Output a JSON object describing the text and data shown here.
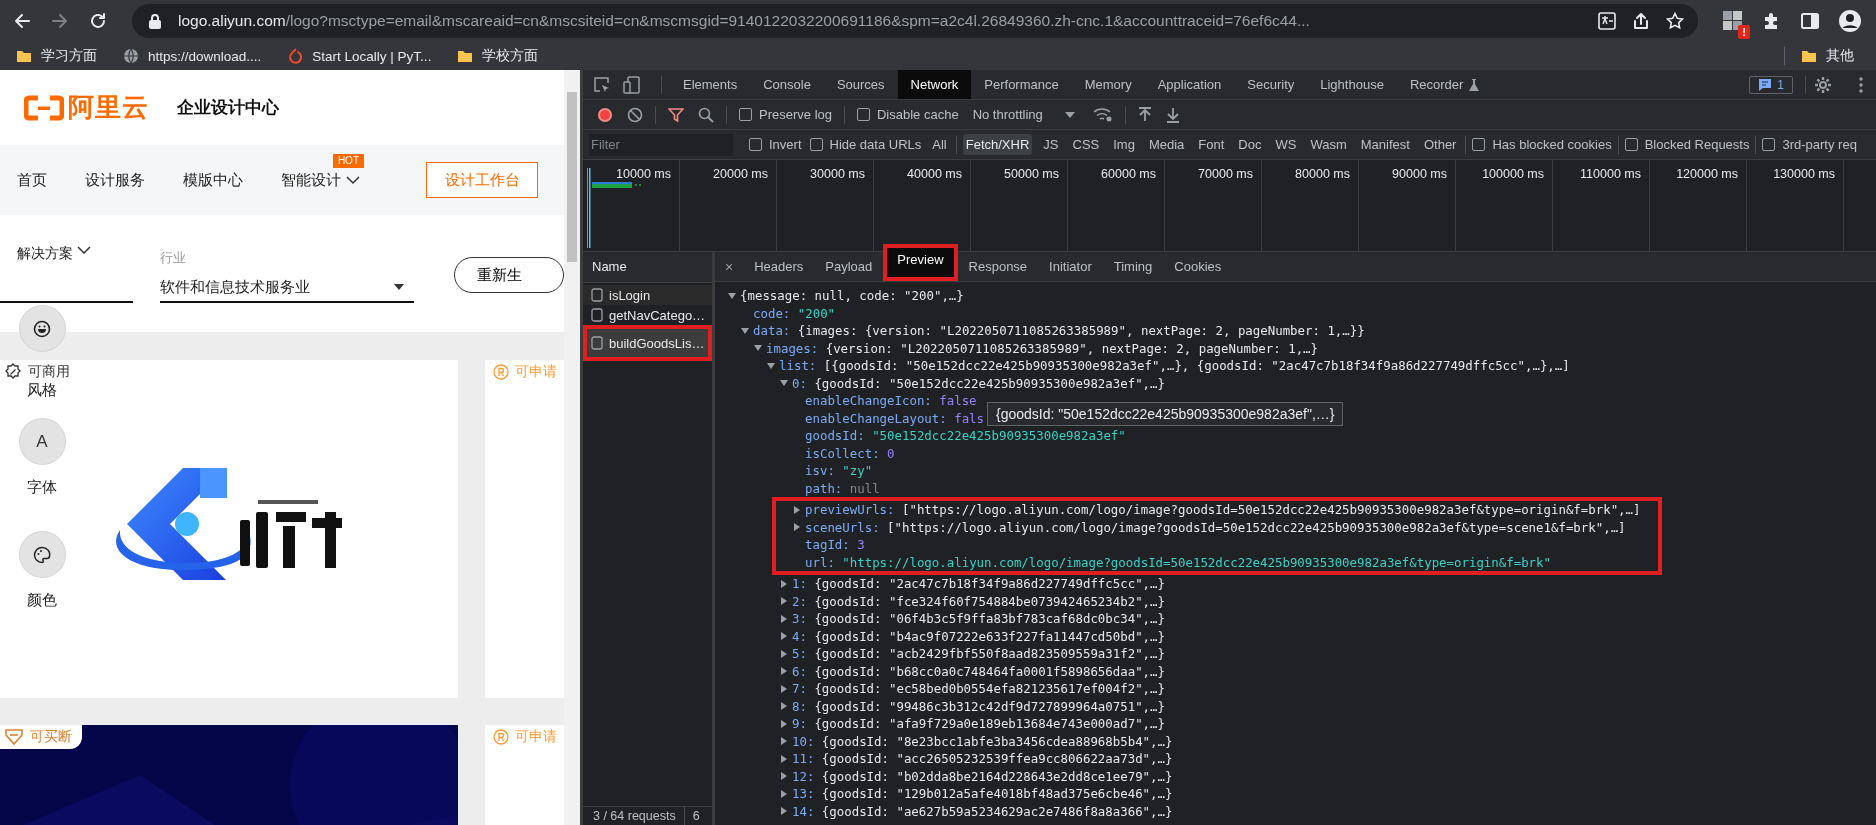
{
  "browser": {
    "address": {
      "host": "logo.aliyun.com",
      "path": "/logo?msctype=email&mscareaid=cn&mscsiteid=cn&mscmsgid=9140122032200691186&spm=a2c4l.26849360.zh-cnc.1&accounttraceid=76ef6c44..."
    },
    "extension_badge": "!",
    "bookmarks": [
      {
        "label": "学习方面",
        "kind": "folder"
      },
      {
        "label": "https://download....",
        "kind": "globe"
      },
      {
        "label": "Start Locally | PyT...",
        "kind": "ring"
      },
      {
        "label": "学校方面",
        "kind": "folder"
      }
    ],
    "other_bookmarks": "其他"
  },
  "page": {
    "brand": {
      "logo_text": "阿里云",
      "title": "企业设计中心"
    },
    "nav": [
      {
        "label": "首页"
      },
      {
        "label": "设计服务"
      },
      {
        "label": "模版中心"
      },
      {
        "label": "智能设计",
        "badge": "HOT",
        "dropdown": true
      }
    ],
    "workbench_button": "设计工作台",
    "solution": {
      "label": "解决方案"
    },
    "industry": {
      "label": "行业",
      "value": "软件和信息技术服务业"
    },
    "regenerate_button": "重新生",
    "tools": [
      {
        "label": "风格",
        "kind": "face"
      },
      {
        "label": "字体",
        "kind": "glyph",
        "glyph": "A"
      },
      {
        "label": "颜色",
        "kind": "palette"
      }
    ],
    "cards": [
      {
        "badge": {
          "text": "可商用",
          "kind": "commercial"
        },
        "kind": "light_picture"
      },
      {
        "badge": {
          "text": "可申请",
          "kind": "trademark"
        },
        "kind": "blank"
      },
      {
        "badge": {
          "text": "可买断",
          "kind": "buyout"
        },
        "kind": "dark_picture"
      },
      {
        "badge": {
          "text": "可申请",
          "kind": "trademark"
        },
        "kind": "blank"
      }
    ]
  },
  "devtools": {
    "tabs": [
      {
        "label": "Elements",
        "selected": false
      },
      {
        "label": "Console",
        "selected": false
      },
      {
        "label": "Sources",
        "selected": false
      },
      {
        "label": "Network",
        "selected": true
      },
      {
        "label": "Performance",
        "selected": false
      },
      {
        "label": "Memory",
        "selected": false
      },
      {
        "label": "Application",
        "selected": false
      },
      {
        "label": "Security",
        "selected": false
      },
      {
        "label": "Lighthouse",
        "selected": false
      },
      {
        "label": "Recorder",
        "selected": false
      }
    ],
    "issues_count": "1",
    "recording": true,
    "filter_active": true,
    "preserve_log": {
      "label": "Preserve log",
      "checked": false
    },
    "disable_cache": {
      "label": "Disable cache",
      "checked": false
    },
    "throttling": "No throttling",
    "filter": {
      "placeholder": "Filter"
    },
    "invert": {
      "label": "Invert",
      "checked": false
    },
    "hide_data_urls": {
      "label": "Hide data URLs",
      "checked": false
    },
    "types": [
      {
        "label": "All",
        "selected": false
      },
      {
        "label": "Fetch/XHR",
        "selected": true
      },
      {
        "label": "JS",
        "selected": false
      },
      {
        "label": "CSS",
        "selected": false
      },
      {
        "label": "Img",
        "selected": false
      },
      {
        "label": "Media",
        "selected": false
      },
      {
        "label": "Font",
        "selected": false
      },
      {
        "label": "Doc",
        "selected": false
      },
      {
        "label": "WS",
        "selected": false
      },
      {
        "label": "Wasm",
        "selected": false
      },
      {
        "label": "Manifest",
        "selected": false
      },
      {
        "label": "Other",
        "selected": false
      }
    ],
    "has_blocked_cookies": {
      "label": "Has blocked cookies",
      "checked": false
    },
    "blocked_requests": {
      "label": "Blocked Requests",
      "checked": false
    },
    "third_party": {
      "label": "3rd-party req",
      "checked": false
    },
    "overview_ticks": [
      "10000 ms",
      "20000 ms",
      "30000 ms",
      "40000 ms",
      "50000 ms",
      "60000 ms",
      "70000 ms",
      "80000 ms",
      "90000 ms",
      "100000 ms",
      "110000 ms",
      "120000 ms",
      "130000 ms"
    ],
    "name_header": "Name",
    "requests": [
      {
        "name": "isLogin",
        "selected": false,
        "highlighted": false
      },
      {
        "name": "getNavCatego…",
        "selected": false,
        "highlighted": false
      },
      {
        "name": "buildGoodsLis…",
        "selected": true,
        "highlighted": true
      }
    ],
    "status": "3 / 64 requests",
    "status_extra": "6",
    "detail_close": "×",
    "detail_tabs": [
      {
        "label": "Headers",
        "selected": false,
        "highlighted": false
      },
      {
        "label": "Payload",
        "selected": false,
        "highlighted": false
      },
      {
        "label": "Preview",
        "selected": true,
        "highlighted": true
      },
      {
        "label": "Response",
        "selected": false,
        "highlighted": false
      },
      {
        "label": "Initiator",
        "selected": false,
        "highlighted": false
      },
      {
        "label": "Timing",
        "selected": false,
        "highlighted": false
      },
      {
        "label": "Cookies",
        "selected": false,
        "highlighted": false
      }
    ],
    "preview": {
      "kind": "branch",
      "expanded": true,
      "value": {
        "text": "{message: null, code: \"200\",…}",
        "kind": "preview"
      },
      "children": [
        {
          "kind": "leaf",
          "key": "code:",
          "value": {
            "text": "\"200\"",
            "kind": "string"
          }
        },
        {
          "kind": "branch",
          "expanded": true,
          "key": "data:",
          "value": {
            "text": "{images: {version: \"L2022050711085263385989\", nextPage: 2, pageNumber: 1,…}}",
            "kind": "preview"
          },
          "children": [
            {
              "kind": "branch",
              "expanded": true,
              "key": "images:",
              "value": {
                "text": "{version: \"L2022050711085263385989\", nextPage: 2, pageNumber: 1,…}",
                "kind": "preview"
              },
              "children": [
                {
                  "kind": "branch",
                  "expanded": true,
                  "key": "list:",
                  "value": {
                    "text": "[{goodsId: \"50e152dcc22e425b90935300e982a3ef\",…}, {goodsId: \"2ac47c7b18f34f9a86d227749dffc5cc\",…},…]",
                    "kind": "preview"
                  },
                  "children": [
                    {
                      "kind": "branch",
                      "expanded": true,
                      "key": "0:",
                      "value": {
                        "text": "{goodsId: \"50e152dcc22e425b90935300e982a3ef\",…}",
                        "kind": "preview"
                      },
                      "children": [
                        {
                          "kind": "leaf",
                          "key": "enableChangeIcon:",
                          "value": {
                            "text": "false",
                            "kind": "boolean"
                          },
                          "highlighted": false
                        },
                        {
                          "kind": "leaf",
                          "key": "enableChangeLayout:",
                          "value": {
                            "text": "fals",
                            "kind": "boolean"
                          },
                          "highlighted": false
                        },
                        {
                          "kind": "leaf",
                          "key": "goodsId:",
                          "value": {
                            "text": "\"50e152dcc22e425b90935300e982a3ef\"",
                            "kind": "string"
                          },
                          "highlighted": false
                        },
                        {
                          "kind": "leaf",
                          "key": "isCollect:",
                          "value": {
                            "text": "0",
                            "kind": "number"
                          },
                          "highlighted": false
                        },
                        {
                          "kind": "leaf",
                          "key": "isv:",
                          "value": {
                            "text": "\"zy\"",
                            "kind": "string"
                          },
                          "highlighted": false
                        },
                        {
                          "kind": "leaf",
                          "key": "path:",
                          "value": {
                            "text": "null",
                            "kind": "null"
                          },
                          "highlighted": false
                        },
                        {
                          "kind": "branch",
                          "expanded": false,
                          "key": "previewUrls:",
                          "value": {
                            "text": "[\"https://logo.aliyun.com/logo/image?goodsId=50e152dcc22e425b90935300e982a3ef&type=origin&f=brk\",…]",
                            "kind": "preview"
                          },
                          "highlighted": true
                        },
                        {
                          "kind": "branch",
                          "expanded": false,
                          "key": "sceneUrls:",
                          "value": {
                            "text": "[\"https://logo.aliyun.com/logo/image?goodsId=50e152dcc22e425b90935300e982a3ef&type=scene1&f=brk\",…]",
                            "kind": "preview"
                          },
                          "highlighted": true
                        },
                        {
                          "kind": "leaf",
                          "key": "tagId:",
                          "value": {
                            "text": "3",
                            "kind": "number"
                          },
                          "highlighted": true
                        },
                        {
                          "kind": "leaf",
                          "key": "url:",
                          "value": {
                            "text": "\"https://logo.aliyun.com/logo/image?goodsId=50e152dcc22e425b90935300e982a3ef&type=origin&f=brk\"",
                            "kind": "string"
                          },
                          "highlighted": true
                        }
                      ]
                    },
                    {
                      "kind": "branch",
                      "expanded": false,
                      "key": "1:",
                      "value": {
                        "text": "{goodsId: \"2ac47c7b18f34f9a86d227749dffc5cc\",…}",
                        "kind": "preview"
                      }
                    },
                    {
                      "kind": "branch",
                      "expanded": false,
                      "key": "2:",
                      "value": {
                        "text": "{goodsId: \"fce324f60f754884be073942465234b2\",…}",
                        "kind": "preview"
                      }
                    },
                    {
                      "kind": "branch",
                      "expanded": false,
                      "key": "3:",
                      "value": {
                        "text": "{goodsId: \"06f4b3c5f9ffa83bf783caf68dc0bc34\",…}",
                        "kind": "preview"
                      }
                    },
                    {
                      "kind": "branch",
                      "expanded": false,
                      "key": "4:",
                      "value": {
                        "text": "{goodsId: \"b4ac9f07222e633f227fa11447cd50bd\",…}",
                        "kind": "preview"
                      }
                    },
                    {
                      "kind": "branch",
                      "expanded": false,
                      "key": "5:",
                      "value": {
                        "text": "{goodsId: \"acb2429fbf550f8aad823509559a31f2\",…}",
                        "kind": "preview"
                      }
                    },
                    {
                      "kind": "branch",
                      "expanded": false,
                      "key": "6:",
                      "value": {
                        "text": "{goodsId: \"b68cc0a0c748464fa0001f5898656daa\",…}",
                        "kind": "preview"
                      }
                    },
                    {
                      "kind": "branch",
                      "expanded": false,
                      "key": "7:",
                      "value": {
                        "text": "{goodsId: \"ec58bed0b0554efa821235617ef004f2\",…}",
                        "kind": "preview"
                      }
                    },
                    {
                      "kind": "branch",
                      "expanded": false,
                      "key": "8:",
                      "value": {
                        "text": "{goodsId: \"99486c3b312c42df9d727899964a0751\",…}",
                        "kind": "preview"
                      }
                    },
                    {
                      "kind": "branch",
                      "expanded": false,
                      "key": "9:",
                      "value": {
                        "text": "{goodsId: \"afa9f729a0e189eb13684e743e000ad7\",…}",
                        "kind": "preview"
                      }
                    },
                    {
                      "kind": "branch",
                      "expanded": false,
                      "key": "10:",
                      "value": {
                        "text": "{goodsId: \"8e23bcc1abfe3ba3456cdea88968b5b4\",…}",
                        "kind": "preview"
                      }
                    },
                    {
                      "kind": "branch",
                      "expanded": false,
                      "key": "11:",
                      "value": {
                        "text": "{goodsId: \"acc26505232539ffea9cc806622aa73d\",…}",
                        "kind": "preview"
                      }
                    },
                    {
                      "kind": "branch",
                      "expanded": false,
                      "key": "12:",
                      "value": {
                        "text": "{goodsId: \"b02dda8be2164d228643e2dd8ce1ee79\",…}",
                        "kind": "preview"
                      }
                    },
                    {
                      "kind": "branch",
                      "expanded": false,
                      "key": "13:",
                      "value": {
                        "text": "{goodsId: \"129b012a5afe4018bf48ad375e6cbe46\",…}",
                        "kind": "preview"
                      }
                    },
                    {
                      "kind": "branch",
                      "expanded": false,
                      "key": "14:",
                      "value": {
                        "text": "{goodsId: \"ae627b59a5234629ac2e7486f8a8a366\",…}",
                        "kind": "preview"
                      }
                    }
                  ]
                }
              ]
            }
          ]
        }
      ]
    },
    "tooltip": "{goodsId: \"50e152dcc22e425b90935300e982a3ef\",…}"
  }
}
